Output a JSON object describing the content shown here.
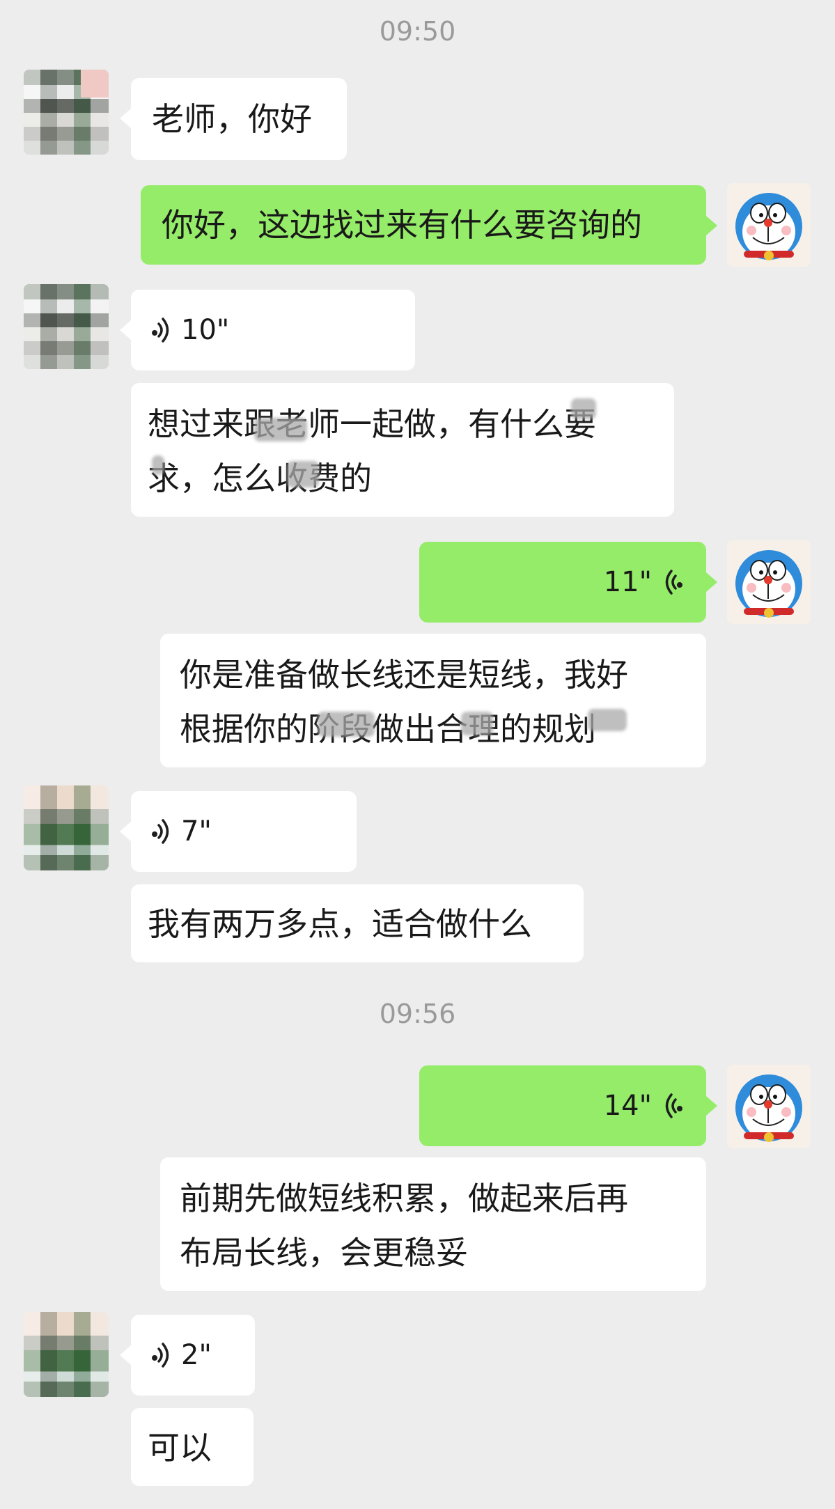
{
  "timestamps": {
    "first": "09:50",
    "second": "09:56"
  },
  "messages": {
    "m1": "老师，你好",
    "m2": "你好，这边找过来有什么要咨询的",
    "m3_voice": "10\"",
    "m4_line1": "想过来跟老师一起做，有什么要",
    "m4_line2": "求，怎么收费的",
    "m5_voice": "11\"",
    "m6_line1": "你是准备做长线还是短线，我好",
    "m6_line2": "根据你的阶段做出合理的规划",
    "m7_voice": "7\"",
    "m8": "我有两万多点，适合做什么",
    "m9_voice": "14\"",
    "m10_line1": "前期先做短线积累，做起来后再",
    "m10_line2": "布局长线，会更稳妥",
    "m11_voice": "2\"",
    "m12": "可以"
  },
  "icons": {
    "incoming_voice": "voice-icon-incoming",
    "outgoing_voice": "voice-icon-outgoing",
    "left_avatar": "pixelated-avatar",
    "right_avatar": "cartoon-robot-cat-avatar"
  },
  "colors": {
    "background": "#ededed",
    "incoming_bubble": "#ffffff",
    "outgoing_bubble": "#95ec69",
    "timestamp": "#9a9a9a"
  }
}
